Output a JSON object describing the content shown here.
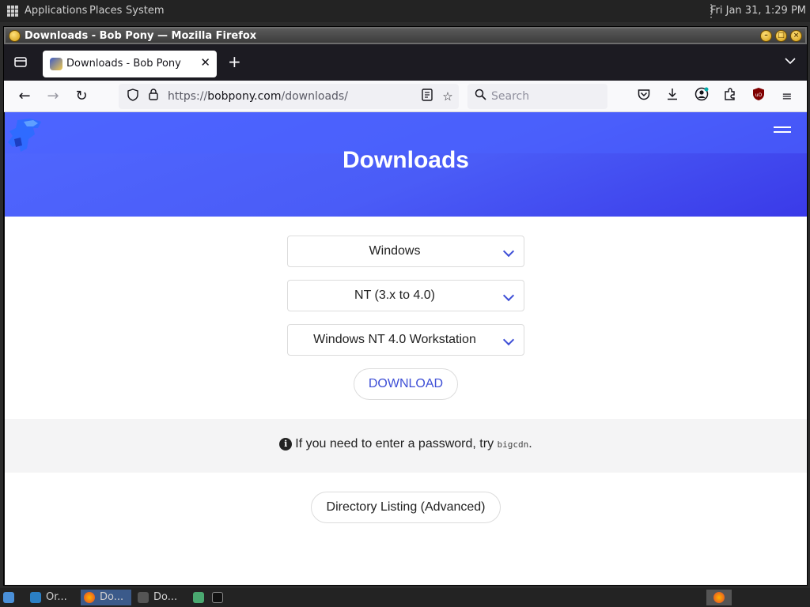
{
  "top_panel": {
    "menus": [
      "Applications",
      "Places",
      "System"
    ],
    "clock": "Fri Jan 31,  1:29 PM"
  },
  "window": {
    "title": "Downloads - Bob Pony — Mozilla Firefox"
  },
  "tab": {
    "title": "Downloads - Bob Pony",
    "close": "✕"
  },
  "navbar": {
    "url_scheme": "https://",
    "url_host": "bobpony.com",
    "url_path": "/downloads/",
    "search_placeholder": "Search"
  },
  "page": {
    "heading": "Downloads",
    "selects": [
      {
        "value": "Windows"
      },
      {
        "value": "NT (3.x to 4.0)"
      },
      {
        "value": "Windows NT 4.0 Workstation"
      }
    ],
    "download_label": "DOWNLOAD",
    "notice_prefix": "If you need to enter a password, try",
    "notice_code": "bigcdn",
    "notice_suffix": ".",
    "directory_label": "Directory Listing (Advanced)"
  },
  "taskbar": {
    "items": [
      "Or...",
      "Do...",
      "Do..."
    ]
  },
  "colors": {
    "accent": "#3e4fd6",
    "hero": "#4a5cf7"
  }
}
